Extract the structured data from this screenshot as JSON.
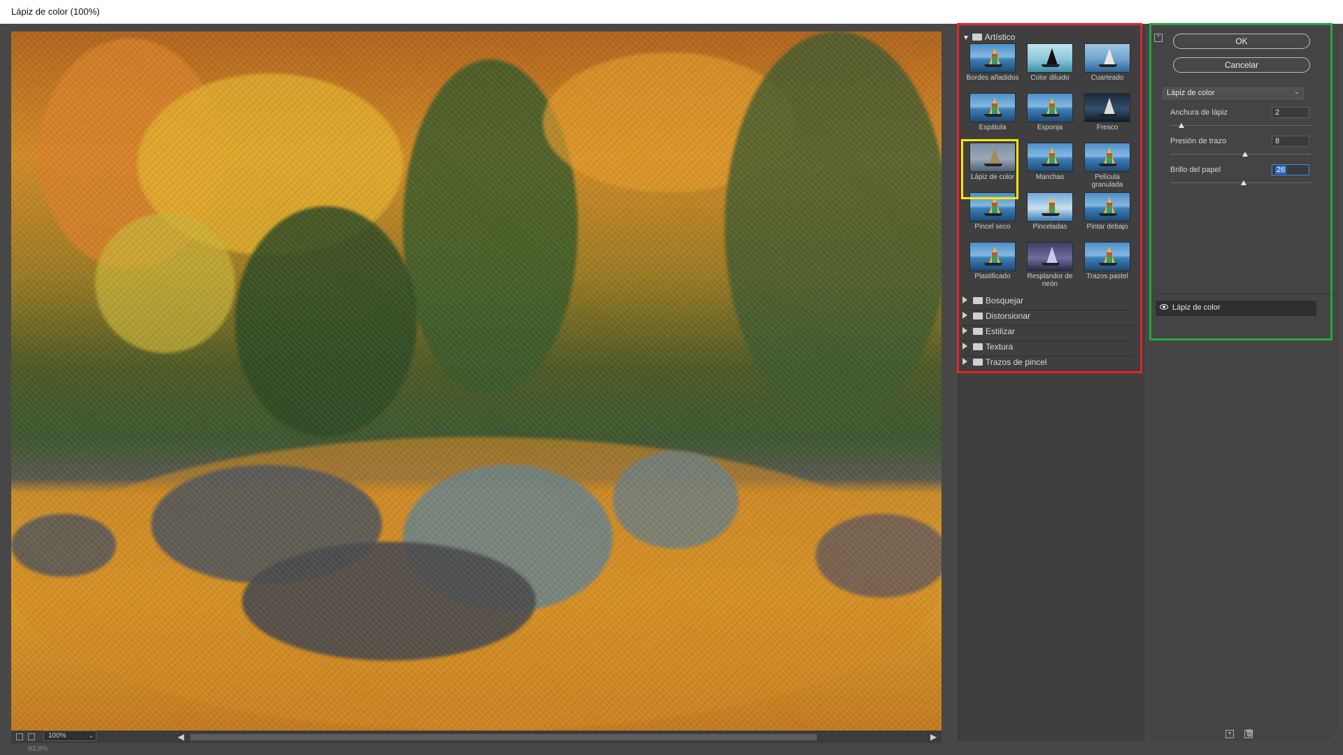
{
  "window": {
    "title": "Lápiz de color (100%)"
  },
  "preview": {
    "zoom": "100%",
    "status": "93,8%"
  },
  "browser": {
    "open_category": "Artístico",
    "thumbnails": [
      {
        "label": "Bordes añadidos"
      },
      {
        "label": "Color diluido"
      },
      {
        "label": "Cuarteado"
      },
      {
        "label": "Espátula"
      },
      {
        "label": "Esponja"
      },
      {
        "label": "Fresco"
      },
      {
        "label": "Lápiz de color"
      },
      {
        "label": "Manchas"
      },
      {
        "label": "Película granulada"
      },
      {
        "label": "Pincel seco"
      },
      {
        "label": "Pinceladas"
      },
      {
        "label": "Pintar debajo"
      },
      {
        "label": "Plastificado"
      },
      {
        "label": "Resplandor de neón"
      },
      {
        "label": "Trazos pastel"
      }
    ],
    "selected": "Lápiz de color",
    "categories": [
      "Bosquejar",
      "Distorsionar",
      "Estilizar",
      "Textura",
      "Trazos de pincel"
    ]
  },
  "panel": {
    "ok": "OK",
    "cancel": "Cancelar",
    "filter_select": "Lápiz de color",
    "params": [
      {
        "label": "Anchura de lápiz",
        "value": "2",
        "level": 0.08
      },
      {
        "label": "Presión de trazo",
        "value": "8",
        "level": 0.53
      },
      {
        "label": "Brillo del papel",
        "value": "26",
        "level": 0.52
      }
    ],
    "layer": "Lápiz de color"
  },
  "colors": {
    "highlight_red": "#e0262a",
    "highlight_green": "#24a646",
    "highlight_yellow": "#ffe600"
  }
}
